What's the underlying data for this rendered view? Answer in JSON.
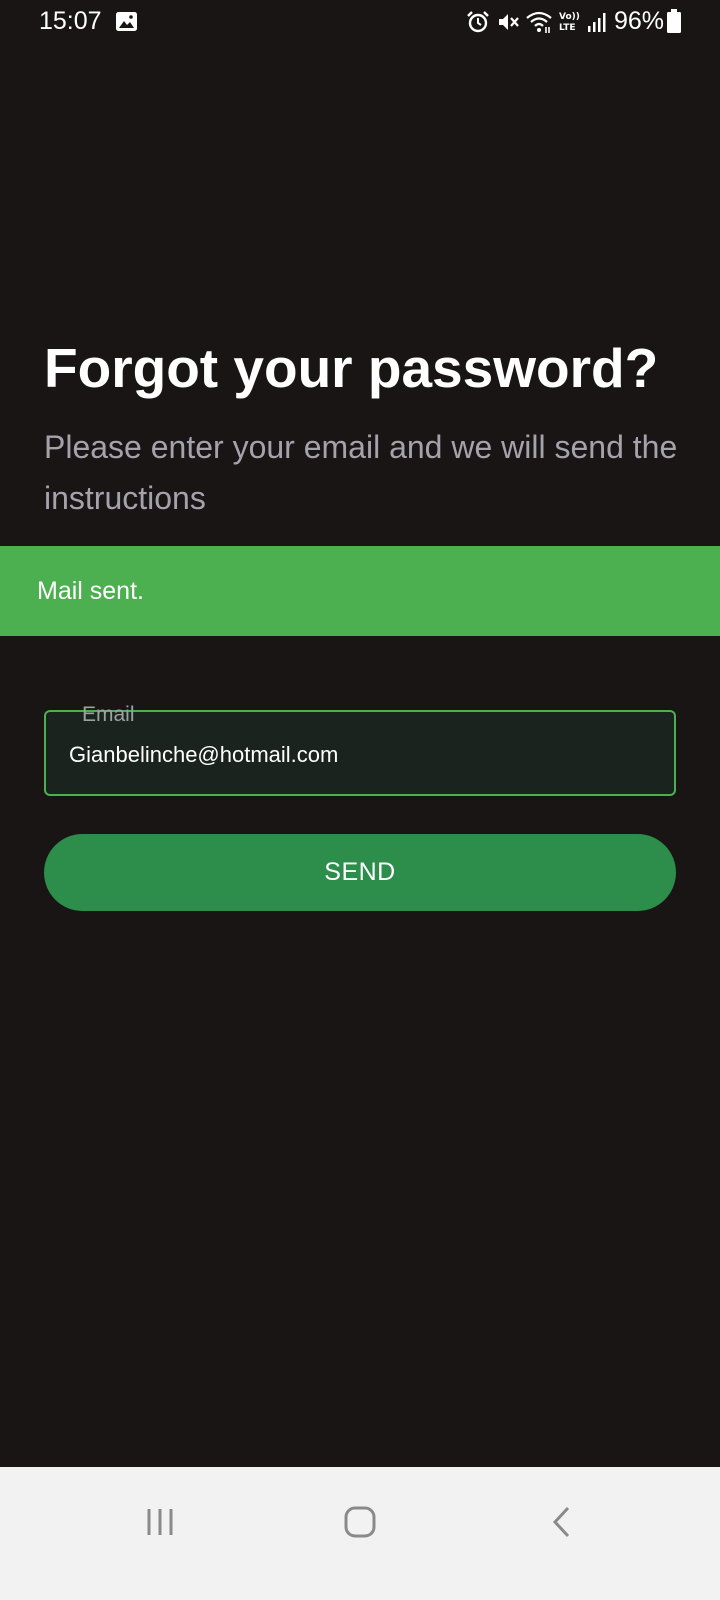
{
  "status_bar": {
    "time": "15:07",
    "battery": "96%",
    "icons": [
      "image-icon",
      "alarm-icon",
      "mute-icon",
      "wifi-icon",
      "volte-icon",
      "signal-icon",
      "battery-icon"
    ]
  },
  "page": {
    "title": "Forgot your password?",
    "subtitle": "Please enter your email and we will send the instructions"
  },
  "snackbar": {
    "message": "Mail sent."
  },
  "email_field": {
    "label": "Email",
    "value": "Gianbelinche@hotmail.com"
  },
  "send_button": {
    "label": "SEND"
  },
  "nav_bar": {
    "icons": [
      "recent-apps-icon",
      "home-icon",
      "back-icon"
    ]
  },
  "colors": {
    "background": "#191515",
    "accent_green": "#4caf50",
    "button_green": "#2d8d4a",
    "subtitle_gray": "#a6a2ac",
    "nav_bar_bg": "#f2f2f2"
  }
}
